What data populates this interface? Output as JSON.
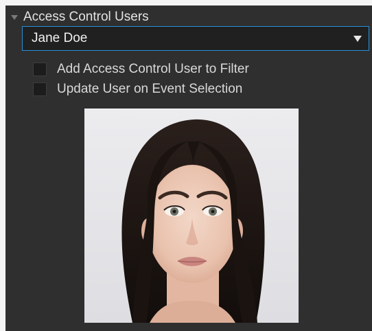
{
  "section": {
    "title": "Access Control Users",
    "expanded": true
  },
  "user_select": {
    "selected": "Jane Doe"
  },
  "options": [
    {
      "label": "Add Access Control User to Filter",
      "checked": false
    },
    {
      "label": "Update User on Event Selection",
      "checked": false
    }
  ],
  "photo": {
    "subject": "user-portrait"
  },
  "colors": {
    "panel_bg": "#2f2f2f",
    "dropdown_border": "#2a8fd6",
    "text": "#e4e4e4"
  }
}
